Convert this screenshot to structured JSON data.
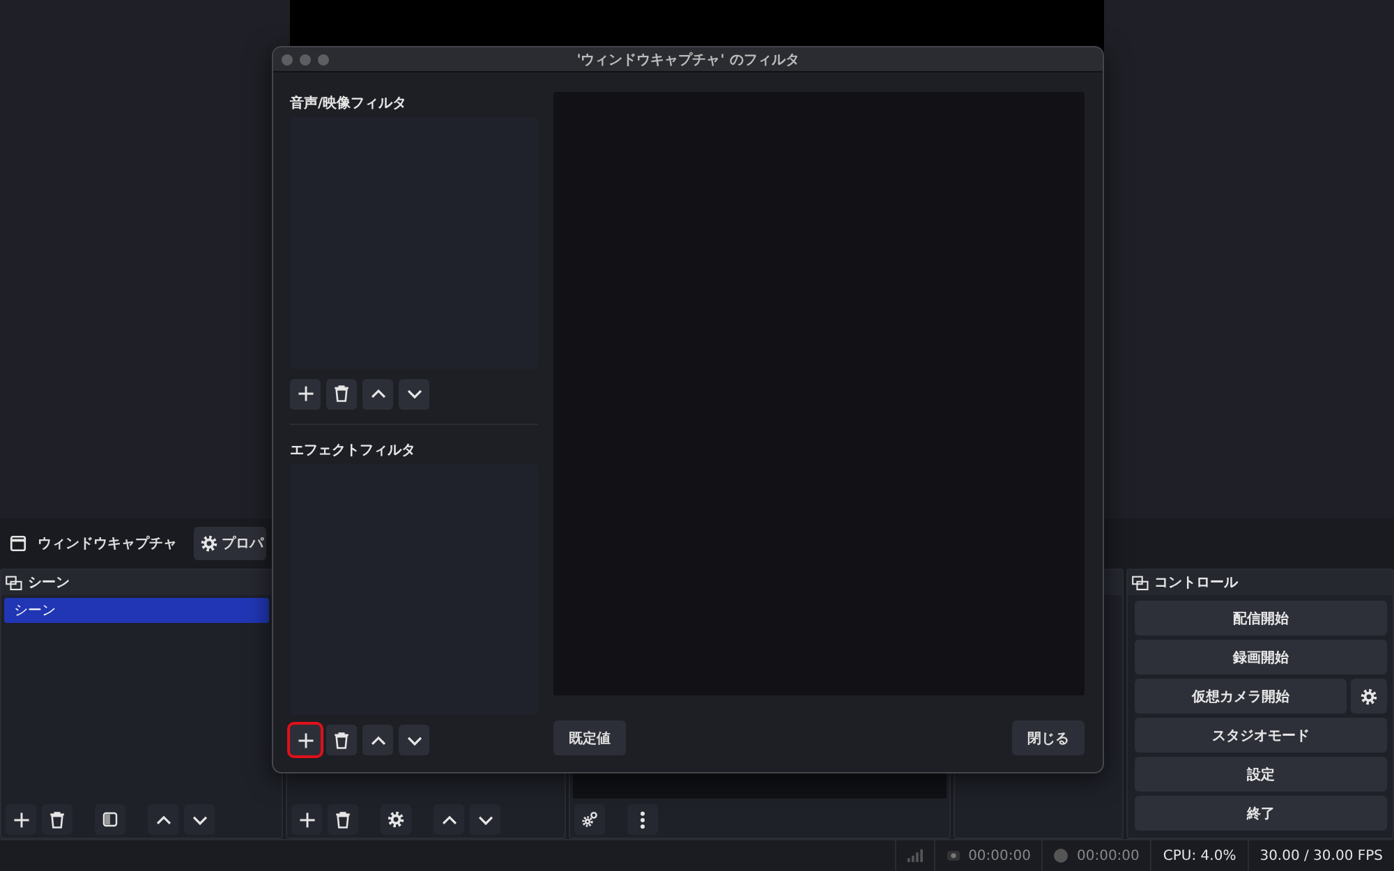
{
  "main": {
    "context_bar": {
      "source_name": "ウィンドウキャプチャ",
      "properties_button": "プロパ"
    },
    "docks": {
      "scenes": {
        "title": "シーン",
        "items": [
          {
            "label": "シーン",
            "selected": true
          }
        ]
      },
      "controls": {
        "title": "コントロール",
        "buttons": [
          {
            "label": "配信開始",
            "kind": "plain"
          },
          {
            "label": "録画開始",
            "kind": "plain"
          },
          {
            "label": "仮想カメラ開始",
            "kind": "with-settings"
          },
          {
            "label": "スタジオモード",
            "kind": "plain"
          },
          {
            "label": "設定",
            "kind": "plain"
          },
          {
            "label": "終了",
            "kind": "plain"
          }
        ]
      }
    },
    "status_bar": {
      "stream_time": "00:00:00",
      "record_time": "00:00:00",
      "cpu": "CPU: 4.0%",
      "fps": "30.00 / 30.00 FPS"
    }
  },
  "dialog": {
    "title": "'ウィンドウキャプチャ' のフィルタ",
    "sections": [
      {
        "label": "音声/映像フィルタ",
        "add_highlighted": false
      },
      {
        "label": "エフェクトフィルタ",
        "add_highlighted": true
      }
    ],
    "buttons": [
      "既定値",
      "閉じる"
    ]
  }
}
